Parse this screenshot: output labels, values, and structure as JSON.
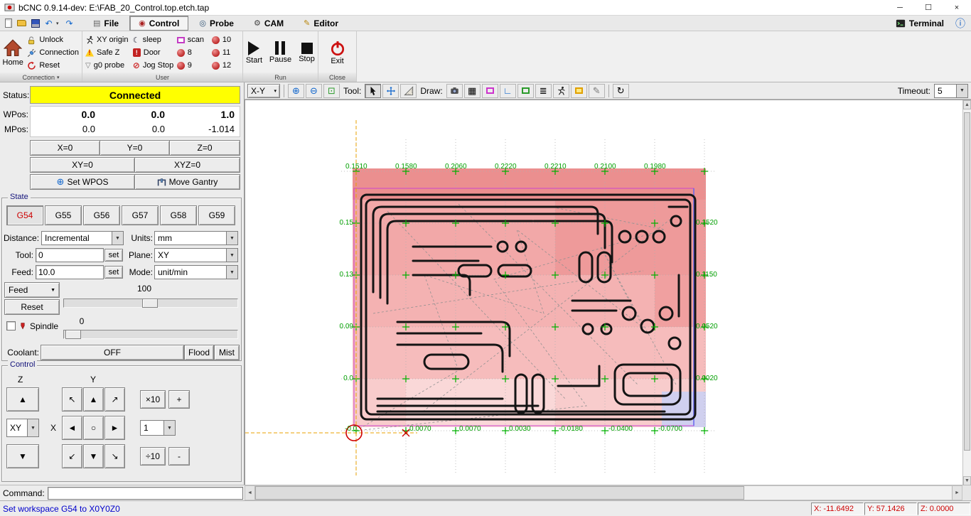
{
  "window": {
    "title": "bCNC 0.9.14-dev: E:\\FAB_20_Control.top.etch.tap"
  },
  "titlebar_controls": {
    "minimize": "─",
    "maximize": "☐",
    "close": "×"
  },
  "icons": {
    "dropdown": "▼",
    "caret": "▾",
    "info": "ⓘ",
    "undo": "↶",
    "redo": "↷",
    "zoom_in": "⊕",
    "zoom_out": "⊖",
    "zoom_fit": "⊡",
    "grid": "▦",
    "axes": "∟",
    "paths": "≣",
    "pencil": "✎",
    "reload": "↻",
    "jog_up": "▲",
    "jog_down": "▼",
    "jog_left": "◄",
    "jog_right": "►",
    "jog_ul": "↖",
    "jog_ur": "↗",
    "jog_dl": "↙",
    "jog_dr": "↘",
    "jog_center": "○",
    "scroll_up": "▲",
    "scroll_down": "▼",
    "scroll_left": "◄",
    "scroll_right": "►",
    "set_wpos": "⊕",
    "g0_probe": "▽",
    "sleep": "☾",
    "jog_stop": "⊘",
    "warning": "!",
    "door": "!",
    "tab_file": "▤",
    "tab_control": "◉",
    "tab_probe": "◎",
    "tab_cam": "⚙",
    "tab_editor": "✎"
  },
  "menubar": {
    "tabs": [
      "File",
      "Control",
      "Probe",
      "CAM",
      "Editor"
    ],
    "active_tab": "Control",
    "terminal": "Terminal"
  },
  "ribbon": {
    "connection": {
      "group_label": "Connection",
      "home": "Home",
      "unlock": "Unlock",
      "connection": "Connection",
      "reset": "Reset"
    },
    "user": {
      "group_label": "User",
      "buttons": [
        "XY origin",
        "Safe Z",
        "g0 probe",
        "sleep",
        "Door",
        "Jog Stop",
        "scan",
        "8",
        "9",
        "10",
        "11",
        "12"
      ]
    },
    "run": {
      "group_label": "Run",
      "start": "Start",
      "pause": "Pause",
      "stop": "Stop"
    },
    "close": {
      "group_label": "Close",
      "exit": "Exit"
    }
  },
  "dro": {
    "status_label": "Status:",
    "status": "Connected",
    "wpos_label": "WPos:",
    "wpos_x": "0.0",
    "wpos_y": "0.0",
    "wpos_z": "1.0",
    "mpos_label": "MPos:",
    "mpos_x": "0.0",
    "mpos_y": "0.0",
    "mpos_z": "-1.014",
    "x0": "X=0",
    "y0": "Y=0",
    "z0": "Z=0",
    "xy0": "XY=0",
    "xyz0": "XYZ=0",
    "set_wpos": "Set WPOS",
    "move_gantry": "Move Gantry"
  },
  "state": {
    "group_label": "State",
    "wcs": [
      "G54",
      "G55",
      "G56",
      "G57",
      "G58",
      "G59"
    ],
    "active_wcs": "G54",
    "distance_label": "Distance:",
    "distance": "Incremental",
    "units_label": "Units:",
    "units": "mm",
    "tool_label": "Tool:",
    "tool": "0",
    "set": "set",
    "plane_label": "Plane:",
    "plane": "XY",
    "feed_label": "Feed:",
    "feed": "10.0",
    "mode_label": "Mode:",
    "mode": "unit/min",
    "feed_menu": "Feed",
    "feed_override": "100",
    "reset": "Reset",
    "spindle": "Spindle",
    "spindle_speed": "0",
    "coolant_label": "Coolant:",
    "coolant_off": "OFF",
    "flood": "Flood",
    "mist": "Mist"
  },
  "control": {
    "group_label": "Control",
    "z_label": "Z",
    "y_label": "Y",
    "x_label": "X",
    "plane": "XY",
    "step": "1",
    "mul": "×10",
    "plus": "+",
    "div": "÷10",
    "minus": "-"
  },
  "canvas_toolbar": {
    "view": "X-Y",
    "tool_label": "Tool:",
    "draw_label": "Draw:",
    "timeout_label": "Timeout:",
    "timeout": "5"
  },
  "canvas": {
    "top_labels": [
      "0.1510",
      "0.1580",
      "0.2060",
      "0.2220",
      "0.2210",
      "0.2100",
      "0.1980"
    ],
    "bottom_labels": [
      "-0.0",
      "0.0070",
      "0.0070",
      "0.0030",
      "-0.0180",
      "-0.0400",
      "-0.0700"
    ],
    "left_labels": [
      "0.15",
      "0.13",
      "0.09",
      "0.0"
    ],
    "right_labels": [
      "0.1520",
      "0.1150",
      "0.0520",
      "0.0020"
    ]
  },
  "command": {
    "label": "Command:"
  },
  "statusbar": {
    "message": "Set workspace G54 to X0Y0Z0",
    "x_label": "X:",
    "x_value": "-11.6492",
    "y_label": "Y:",
    "y_value": "57.1426",
    "z_label": "Z:",
    "z_value": "0.0000"
  },
  "colors": {
    "status_bg": "#ffff00",
    "active_wcs": "#cc0000",
    "message": "#0000cc",
    "coord": "#cc0000",
    "probe_label": "#00a000"
  }
}
